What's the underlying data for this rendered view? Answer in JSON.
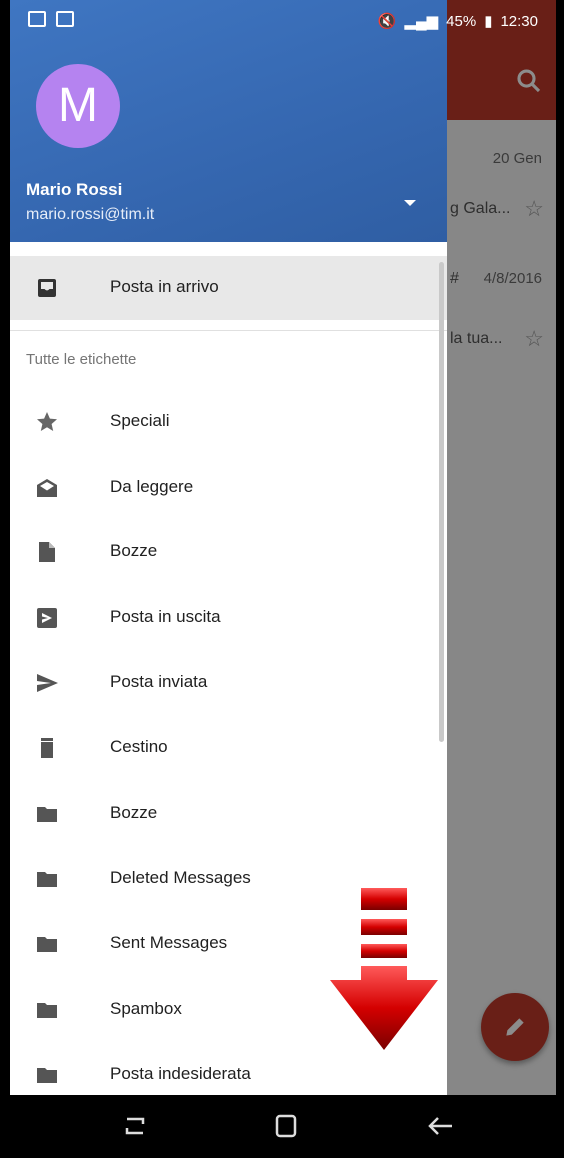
{
  "statusbar": {
    "right_text": "45%",
    "time": "12:30"
  },
  "background": {
    "rows": [
      {
        "date": "20 Gen",
        "snippet": "",
        "star": false
      },
      {
        "date": "",
        "snippet": "g Gala...",
        "star": true
      },
      {
        "date": "4/8/2016",
        "snippet": "#",
        "star": false
      },
      {
        "date": "",
        "snippet": "la tua...",
        "star": true
      }
    ]
  },
  "account": {
    "avatar_letter": "M",
    "name": "Mario Rossi",
    "email": "mario.rossi@tim.it"
  },
  "drawer": {
    "inbox": {
      "label": "Posta in arrivo",
      "icon": "inbox-icon"
    },
    "section_label": "Tutte le etichette",
    "items": [
      {
        "label": "Speciali",
        "icon": "star-icon"
      },
      {
        "label": "Da leggere",
        "icon": "drafts-icon"
      },
      {
        "label": "Bozze",
        "icon": "file-icon"
      },
      {
        "label": "Posta in uscita",
        "icon": "outbox-icon"
      },
      {
        "label": "Posta inviata",
        "icon": "send-icon"
      },
      {
        "label": "Cestino",
        "icon": "trash-icon"
      },
      {
        "label": "Bozze",
        "icon": "folder-icon"
      },
      {
        "label": "Deleted Messages",
        "icon": "folder-icon"
      },
      {
        "label": "Sent Messages",
        "icon": "folder-icon"
      },
      {
        "label": "Spambox",
        "icon": "folder-icon"
      },
      {
        "label": "Posta indesiderata",
        "icon": "folder-icon"
      }
    ]
  },
  "colors": {
    "header_blue": "#3567b0",
    "avatar_purple": "#b583f0",
    "toolbar_red": "#c0392b"
  }
}
